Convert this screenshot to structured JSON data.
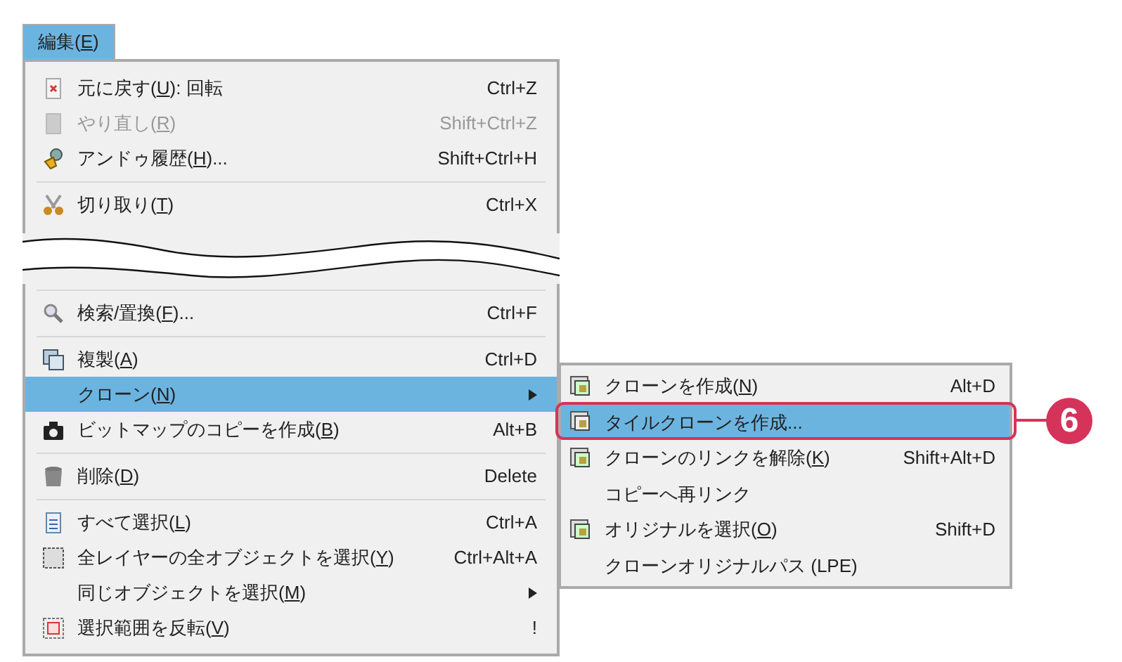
{
  "menu_title": {
    "before": "編集(",
    "key": "E",
    "after": ")",
    "selected": true
  },
  "top_items": [
    {
      "kind": "item",
      "before": "元に戻す(",
      "key": "U",
      "after": "): 回転",
      "shortcut": "Ctrl+Z",
      "disabled": false,
      "selected": false,
      "submenu": false
    },
    {
      "kind": "item",
      "before": "やり直し(",
      "key": "R",
      "after": ")",
      "shortcut": "Shift+Ctrl+Z",
      "disabled": true,
      "selected": false,
      "submenu": false
    },
    {
      "kind": "item",
      "before": "アンドゥ履歴(",
      "key": "H",
      "after": ")...",
      "shortcut": "Shift+Ctrl+H",
      "disabled": false,
      "selected": false,
      "submenu": false
    },
    {
      "kind": "separator"
    },
    {
      "kind": "item",
      "before": "切り取り(",
      "key": "T",
      "after": ")",
      "shortcut": "Ctrl+X",
      "disabled": false,
      "selected": false,
      "submenu": false
    }
  ],
  "bottom_items": [
    {
      "kind": "separator"
    },
    {
      "kind": "item",
      "before": "検索/置換(",
      "key": "F",
      "after": ")...",
      "shortcut": "Ctrl+F",
      "disabled": false,
      "selected": false,
      "submenu": false
    },
    {
      "kind": "separator"
    },
    {
      "kind": "item",
      "before": "複製(",
      "key": "A",
      "after": ")",
      "shortcut": "Ctrl+D",
      "disabled": false,
      "selected": false,
      "submenu": false
    },
    {
      "kind": "item",
      "before": "クローン(",
      "key": "N",
      "after": ")",
      "disabled": false,
      "selected": true,
      "submenu": true
    },
    {
      "kind": "item",
      "before": "ビットマップのコピーを作成(",
      "key": "B",
      "after": ")",
      "shortcut": "Alt+B",
      "disabled": false,
      "selected": false,
      "submenu": false
    },
    {
      "kind": "separator"
    },
    {
      "kind": "item",
      "before": "削除(",
      "key": "D",
      "after": ")",
      "shortcut": "Delete",
      "disabled": false,
      "selected": false,
      "submenu": false
    },
    {
      "kind": "separator"
    },
    {
      "kind": "item",
      "before": "すべて選択(",
      "key": "L",
      "after": ")",
      "shortcut": "Ctrl+A",
      "disabled": false,
      "selected": false,
      "submenu": false
    },
    {
      "kind": "item",
      "before": "全レイヤーの全オブジェクトを選択(",
      "key": "Y",
      "after": ")",
      "shortcut": "Ctrl+Alt+A",
      "disabled": false,
      "selected": false,
      "submenu": false
    },
    {
      "kind": "item",
      "before": "同じオブジェクトを選択(",
      "key": "M",
      "after": ")",
      "disabled": false,
      "selected": false,
      "submenu": true
    },
    {
      "kind": "item",
      "before": "選択範囲を反転(",
      "key": "V",
      "after": ")",
      "shortcut": "!",
      "disabled": false,
      "selected": false,
      "submenu": false
    }
  ],
  "submenu": [
    {
      "before": "クローンを作成(",
      "key": "N",
      "after": ")",
      "shortcut": "Alt+D",
      "selected": false,
      "icon": true
    },
    {
      "before": "タイルクローンを作成...",
      "selected": true,
      "icon": true
    },
    {
      "before": "クローンのリンクを解除(",
      "key": "K",
      "after": ")",
      "shortcut": "Shift+Alt+D",
      "selected": false,
      "icon": true
    },
    {
      "before": "コピーへ再リンク",
      "selected": false,
      "icon": false
    },
    {
      "before": "オリジナルを選択(",
      "key": "O",
      "after": ")",
      "shortcut": "Shift+D",
      "selected": false,
      "icon": true
    },
    {
      "before": "クローンオリジナルパス (LPE)",
      "selected": false,
      "icon": false
    }
  ],
  "callout": {
    "number": "6"
  }
}
